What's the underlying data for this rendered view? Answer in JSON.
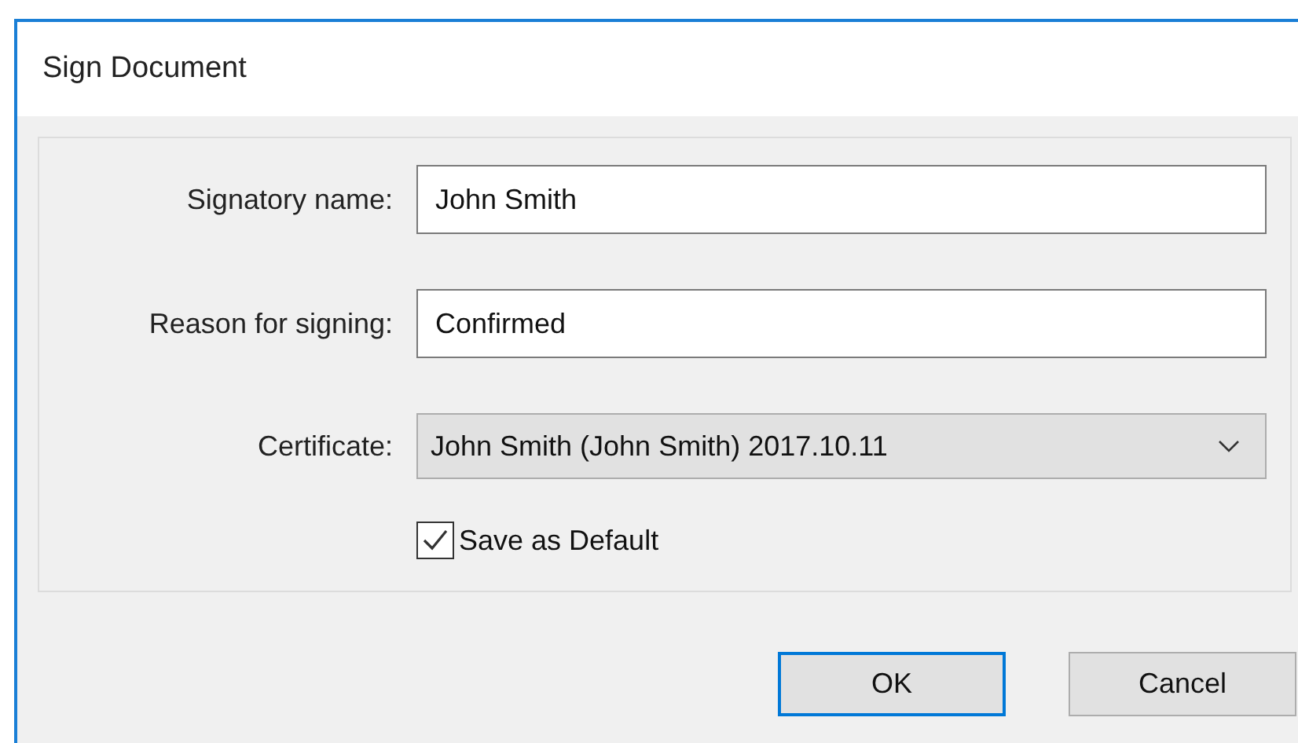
{
  "window": {
    "title": "Sign Document"
  },
  "fields": [
    {
      "label": "Signatory name:",
      "value": "John Smith"
    },
    {
      "label": "Reason for signing:",
      "value": "Confirmed"
    }
  ],
  "certificate": {
    "label": "Certificate:",
    "value": "John Smith (John Smith) 2017.10.11"
  },
  "save_default": {
    "label": "Save as Default",
    "checked": true
  },
  "buttons": [
    {
      "label": "OK",
      "selected": true
    },
    {
      "label": "Cancel",
      "selected": false
    }
  ]
}
